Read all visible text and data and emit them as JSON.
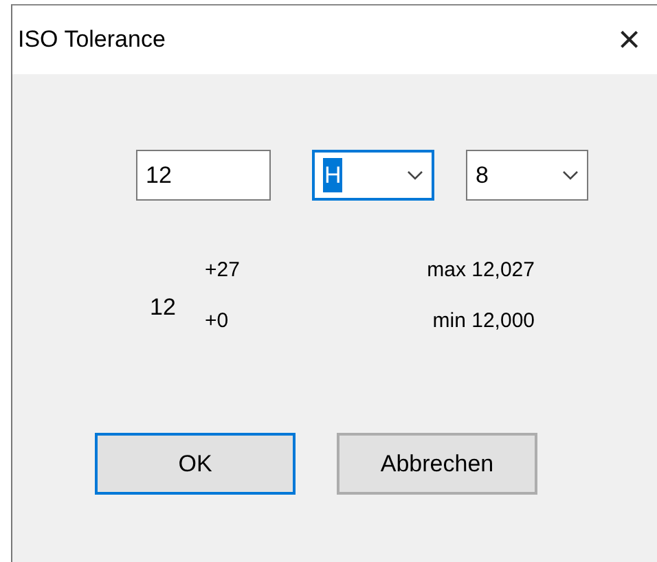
{
  "window": {
    "title": "ISO Tolerance",
    "close": "×"
  },
  "inputs": [
    {
      "kind": "text",
      "value": "12",
      "focused": false
    },
    {
      "kind": "combo",
      "value": "H",
      "focused": true
    },
    {
      "kind": "combo",
      "value": "8",
      "focused": false
    }
  ],
  "result": {
    "nominal": "12",
    "upper_deviation": "+27",
    "lower_deviation": "+0",
    "max": "max 12,027",
    "min": "min 12,000"
  },
  "buttons": [
    {
      "label": "OK",
      "default": true
    },
    {
      "label": "Abbrechen",
      "default": false
    }
  ]
}
